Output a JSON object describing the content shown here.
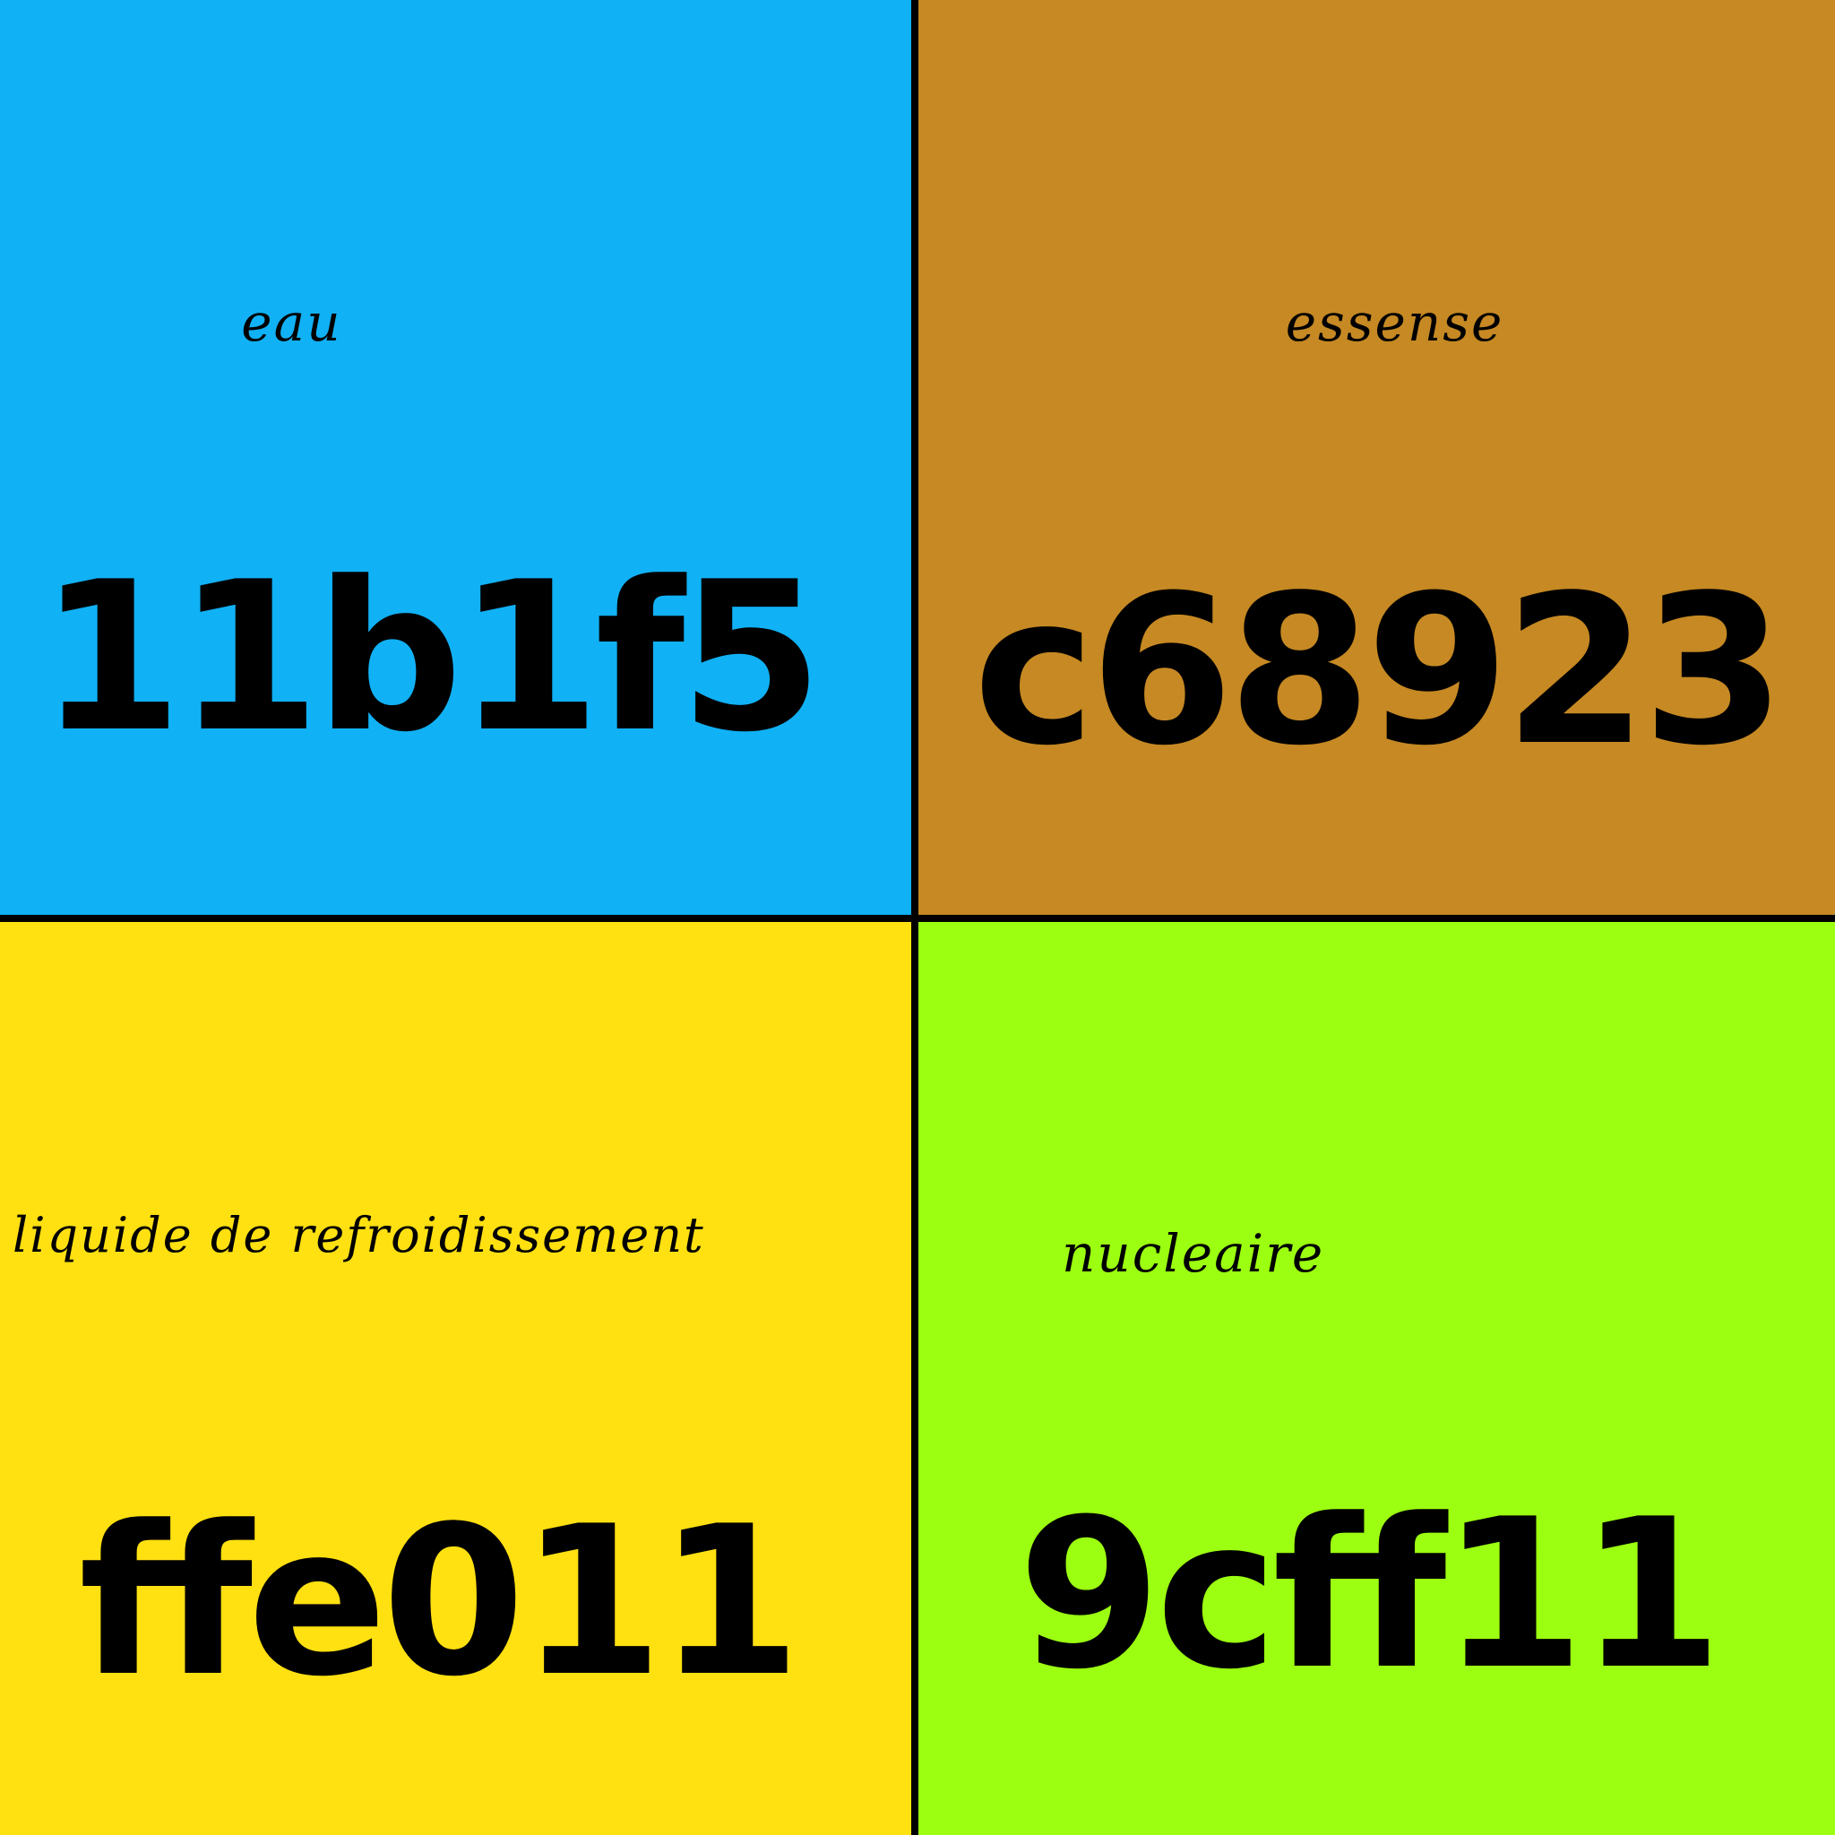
{
  "swatches": [
    {
      "label": "eau",
      "hex": "11b1f5",
      "color": "#11b1f5"
    },
    {
      "label": "essense",
      "hex": "c68923",
      "color": "#c68923"
    },
    {
      "label": "liquide de refroidissement",
      "hex": "ffe011",
      "color": "#ffe011"
    },
    {
      "label": "nucleaire",
      "hex": "9cff11",
      "color": "#9cff11"
    }
  ],
  "divider_color": "#000000"
}
